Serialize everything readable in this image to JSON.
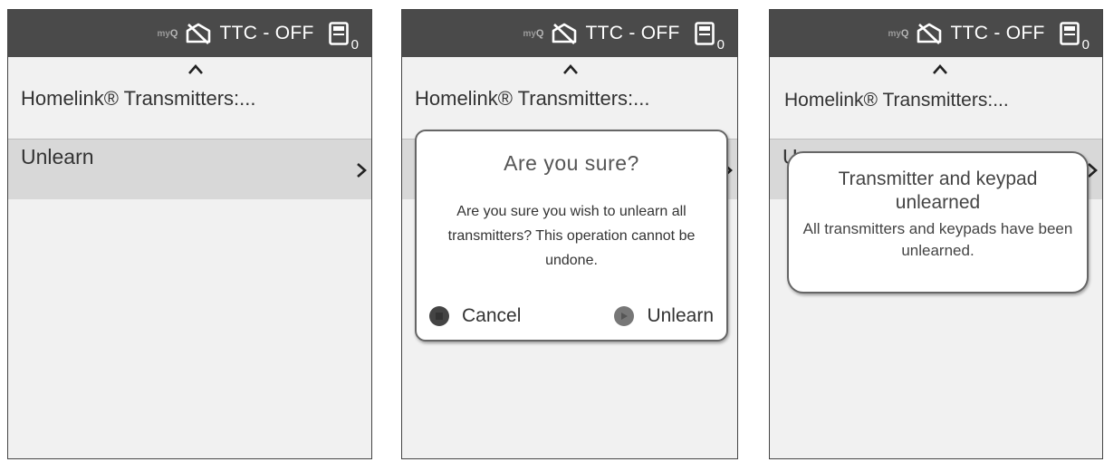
{
  "statusbar": {
    "myq_prefix": "my",
    "myq_suffix": "Q",
    "ttc_label": "TTC - OFF",
    "keypad_count": "0"
  },
  "menu": {
    "title": "Homelink® Transmitters:...",
    "item_label": "Unlearn",
    "item_label_partial": "U"
  },
  "confirm_dialog": {
    "title": "Are you sure?",
    "body": "Are you sure you wish to unlearn all transmitters? This operation cannot be undone.",
    "cancel_label": "Cancel",
    "confirm_label": "Unlearn"
  },
  "notice": {
    "title": "Transmitter and keypad unlearned",
    "body": "All transmitters and keypads have been unlearned."
  },
  "icons": {
    "ttc": "garage-door-off-icon",
    "keypad": "keypad-icon",
    "up": "chevron-up-icon",
    "next": "chevron-right-icon"
  },
  "colors": {
    "statusbar": "#4a4a4a",
    "screen_bg": "#f1f1f1",
    "selected_row": "#d8d8d8"
  }
}
